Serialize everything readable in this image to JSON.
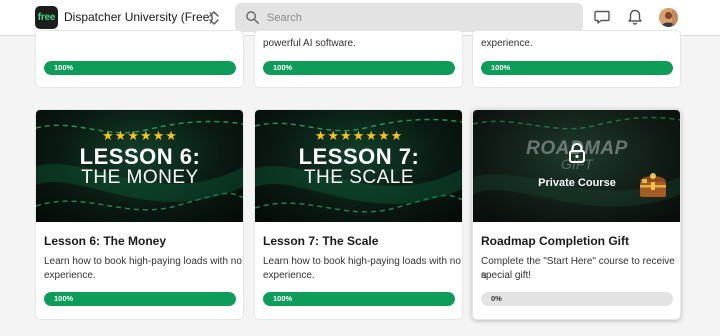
{
  "app": {
    "logo_text": "free",
    "title": "Dispatcher University (Free)"
  },
  "search": {
    "placeholder": "Search",
    "value": ""
  },
  "header_icons": [
    "chat-icon",
    "bell-icon",
    "avatar"
  ],
  "colors": {
    "accent": "#0e9d58",
    "progress_track": "#e3e3e3",
    "logo_text": "#3fdc7d",
    "stars": "#f5c518"
  },
  "top_row": [
    {
      "desc_tail": "",
      "progress": 100,
      "progress_label": "100%"
    },
    {
      "desc_tail": "powerful AI software.",
      "progress": 100,
      "progress_label": "100%"
    },
    {
      "desc_tail": "experience.",
      "progress": 100,
      "progress_label": "100%"
    }
  ],
  "courses": [
    {
      "thumb_stars": "★★★★★★",
      "thumb_line1": "LESSON 6:",
      "thumb_line2": "THE MONEY",
      "title": "Lesson 6: The Money",
      "desc_line1": "Learn how to book high-paying loads with no",
      "desc_line2": "experience.",
      "progress": 100,
      "progress_label": "100%"
    },
    {
      "thumb_stars": "★★★★★★★",
      "thumb_line1": "LESSON 7:",
      "thumb_line2": "THE SCALE",
      "title": "Lesson 7: The Scale",
      "desc_line1": "Learn how to book high-paying loads with no",
      "desc_line2": "experience.",
      "progress": 100,
      "progress_label": "100%"
    },
    {
      "thumb_line1": "ROADMAP",
      "thumb_line2": "GIFT",
      "thumb_badge": "Private Course",
      "title": "Roadmap Completion Gift",
      "desc_line1": "Complete the \"Start Here\" course to receive a",
      "desc_line2": "special gift!",
      "progress": 0,
      "progress_label": "0%"
    }
  ]
}
